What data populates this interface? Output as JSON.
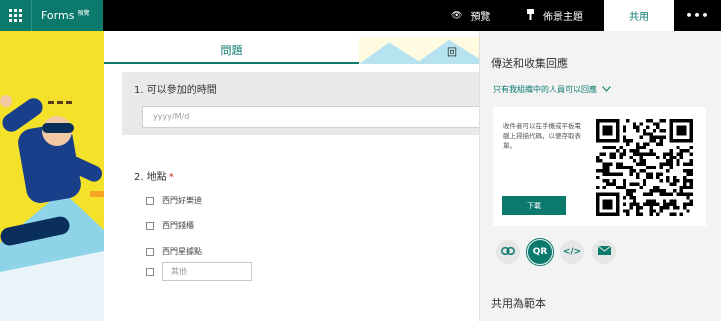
{
  "app": {
    "name": "Forms",
    "badge": "預覽"
  },
  "topbar": {
    "preview_label": "預覽",
    "theme_label": "佈景主題",
    "share_label": "共用",
    "more_label": "•••"
  },
  "tabs": {
    "questions": "問題",
    "responses": "回"
  },
  "form": {
    "q1": {
      "title": "1. 可以參加的時間",
      "placeholder": "yyyy/M/d"
    },
    "q2": {
      "title": "2. 地點",
      "required_mark": "*",
      "options": [
        "西門好樂迪",
        "西門錢櫃",
        "西門星據點"
      ],
      "other_placeholder": "其他"
    }
  },
  "share_pane": {
    "title": "傳送和收集回應",
    "scope": "只有我組織中的人員可以回應",
    "qr_description": "收件者可以在手機或平板電腦上掃描代碼，以便存取表單。",
    "download_label": "下載",
    "share_methods": [
      {
        "name": "link-icon",
        "label": ""
      },
      {
        "name": "qr-icon",
        "label": "QR"
      },
      {
        "name": "embed-icon",
        "label": "</>"
      },
      {
        "name": "mail-icon",
        "label": ""
      }
    ],
    "template_title": "共用為範本"
  },
  "colors": {
    "accent": "#0b7a6c",
    "topbar": "#000000",
    "pane": "#f3f3f3",
    "required": "#c42b1c"
  }
}
